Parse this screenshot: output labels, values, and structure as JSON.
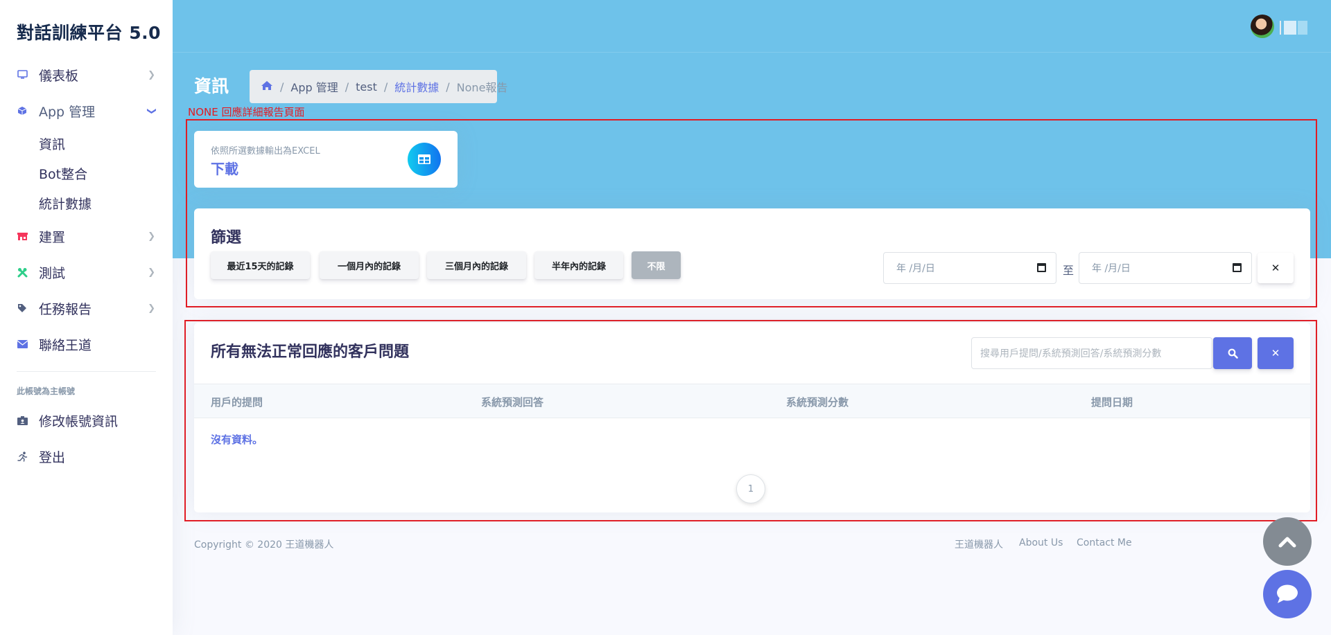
{
  "brand": "對話訓練平台 5.0",
  "sidebar": {
    "nav": [
      {
        "label": "儀表板",
        "icon": "monitor-icon",
        "color": "#5e72e4"
      },
      {
        "label": "App 管理",
        "icon": "cube-icon",
        "color": "#5e72e4",
        "open": true
      },
      {
        "label": "建置",
        "icon": "shop-icon",
        "color": "#f5365c"
      },
      {
        "label": "測試",
        "icon": "tools-icon",
        "color": "#2dce89"
      },
      {
        "label": "任務報告",
        "icon": "tag-icon",
        "color": "#525f7f"
      },
      {
        "label": "聯絡王道",
        "icon": "envelope-icon",
        "color": "#5e72e4"
      }
    ],
    "subnav": [
      "資訊",
      "Bot整合",
      "統計數據"
    ],
    "section_heading": "此帳號為主帳號",
    "account": [
      {
        "label": "修改帳號資訊",
        "icon": "id-card-icon"
      },
      {
        "label": "登出",
        "icon": "running-icon"
      }
    ]
  },
  "header": {
    "page_title": "資訊",
    "breadcrumb": [
      "App 管理",
      "test",
      "統計數據",
      "None報告"
    ]
  },
  "annotation": "NONE 回應詳細報告頁面",
  "export_card": {
    "subtitle": "依照所選數據輸出為EXCEL",
    "action": "下載"
  },
  "filter": {
    "title": "篩選",
    "buttons": [
      "最近15天的記錄",
      "一個月內的記錄",
      "三個月內的記錄",
      "半年內的記錄",
      "不限"
    ],
    "active_button": "不限",
    "date_from": "年 /月/日",
    "to_label": "至",
    "date_to": "年 /月/日",
    "clear": "✕"
  },
  "table": {
    "title": "所有無法正常回應的客戶問題",
    "search_placeholder": "搜尋用戶提問/系統預測回答/系統預測分數",
    "clear": "✕",
    "columns": [
      "用戶的提問",
      "系統預測回答",
      "系統預測分數",
      "提問日期"
    ],
    "empty_text": "沒有資料。",
    "page": "1"
  },
  "footer": {
    "copyright": "Copyright © 2020 王道機器人",
    "links": [
      "王道機器人",
      "About Us",
      "Contact Me"
    ]
  },
  "colors": {
    "header_bg": "#6ec2ea",
    "primary": "#5e72e4",
    "annotation_red": "#e31b23"
  }
}
